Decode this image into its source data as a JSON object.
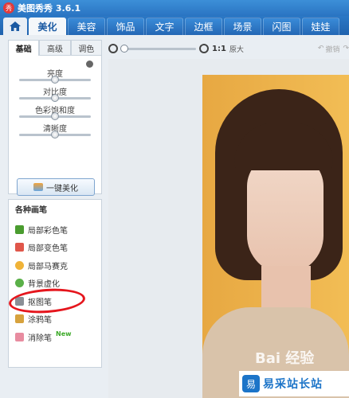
{
  "titlebar": {
    "logo": "秀",
    "title": "美图秀秀 3.6.1"
  },
  "nav": {
    "home_icon": "home-icon",
    "tabs": [
      "美化",
      "美容",
      "饰品",
      "文字",
      "边框",
      "场景",
      "闪图",
      "娃娃"
    ],
    "active": "美化"
  },
  "left": {
    "subtabs": [
      "基础",
      "高级",
      "调色"
    ],
    "sliders": [
      {
        "label": "亮度",
        "level": 0.5
      },
      {
        "label": "对比度",
        "level": 0.5
      },
      {
        "label": "色彩饱和度",
        "level": 0.5
      },
      {
        "label": "清晰度",
        "level": 0.5
      }
    ],
    "onekey_label": "一键美化",
    "brushes_title": "各种画笔",
    "brushes": [
      {
        "label": "局部彩色笔",
        "icon": "color-brush-icon",
        "color": "#4a9c2f"
      },
      {
        "label": "局部变色笔",
        "icon": "recolor-brush-icon",
        "color": "#e0564a"
      },
      {
        "label": "局部马赛克",
        "icon": "mosaic-icon",
        "color": "#f0b338"
      },
      {
        "label": "背景虚化",
        "icon": "blur-icon",
        "color": "#5ab048"
      },
      {
        "label": "抠图笔",
        "icon": "cutout-brush-icon",
        "color": "#8a8f96"
      },
      {
        "label": "涂鸦笔",
        "icon": "doodle-pen-icon",
        "color": "#d7a23d"
      },
      {
        "label": "消除笔",
        "icon": "eraser-icon",
        "color": "#e88ca0"
      }
    ],
    "new_badge": "New"
  },
  "toolbar": {
    "ratio": "1:1",
    "orig_size": "原大",
    "undo": "撤销",
    "redo": "重做",
    "zoom_level": 0.0
  },
  "canvas": {
    "watermark": "Bai 经验",
    "site_logo_mark": "易",
    "site_logo_text": "易采站长站"
  },
  "colors": {
    "title_bar": "#2a74c2",
    "annotation_circle": "#e5161d",
    "photo_background": "#f2bd55"
  }
}
